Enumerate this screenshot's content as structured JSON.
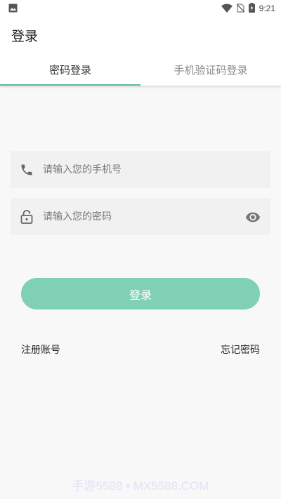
{
  "status_bar": {
    "time": "9:21",
    "icons": [
      "image-icon",
      "wifi-icon",
      "no-sim-icon",
      "battery-charging-icon"
    ]
  },
  "app_bar": {
    "title": "登录"
  },
  "tabs": [
    {
      "label": "密码登录",
      "active": true
    },
    {
      "label": "手机验证码登录",
      "active": false
    }
  ],
  "form": {
    "phone": {
      "placeholder": "请输入您的手机号",
      "value": "",
      "icon": "phone-icon"
    },
    "password": {
      "placeholder": "请输入您的密码",
      "value": "",
      "icon": "lock-icon",
      "toggle_icon": "eye-icon"
    },
    "submit_label": "登录"
  },
  "links": {
    "register": "注册账号",
    "forgot": "忘记密码"
  },
  "watermark": "手游5588 • MX5588.COM",
  "colors": {
    "accent": "#5fb8a0",
    "button": "#80d0b6",
    "field_bg": "#f1f1f1",
    "page_bg": "#f8f8f8"
  }
}
